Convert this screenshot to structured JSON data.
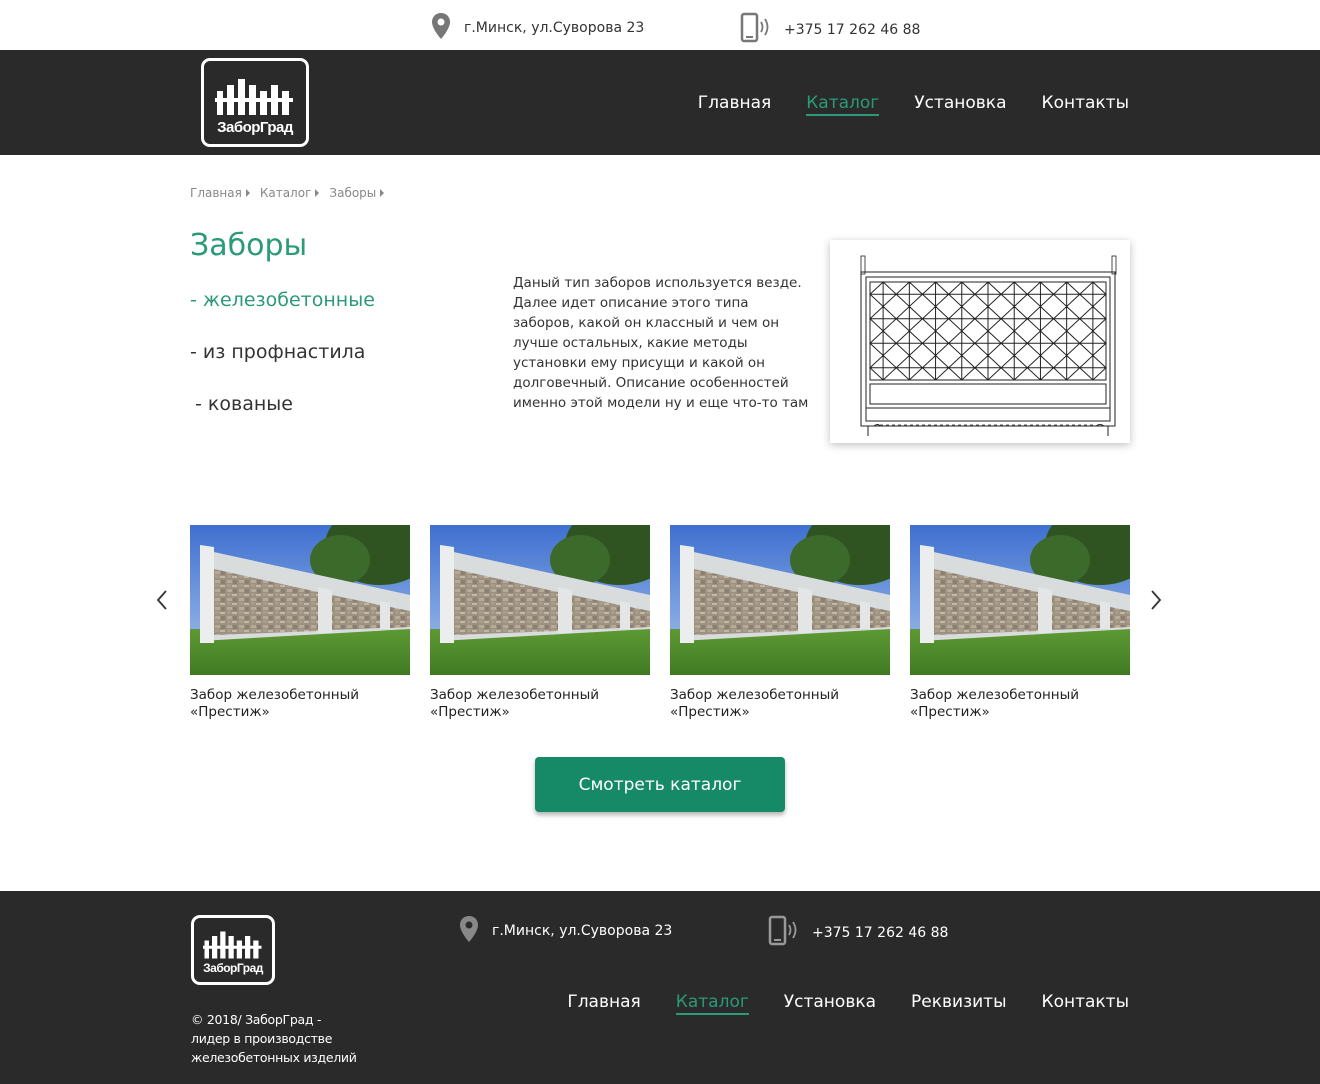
{
  "topbar": {
    "address": "г.Минск, ул.Суворова 23",
    "phone": "+375 17 262 46 88"
  },
  "header": {
    "logo_text": "ЗаборГрад",
    "nav": [
      "Главная",
      "Каталог",
      "Установка",
      "Контакты"
    ],
    "active_nav": "Каталог"
  },
  "breadcrumb": [
    "Главная",
    "Каталог",
    "Заборы"
  ],
  "category": {
    "title": "Заборы",
    "subcategories": [
      "- железобетонные",
      "- из профнастила",
      "- кованые"
    ],
    "active_subcategory": "- железобетонные",
    "description": "Даный тип заборов используется везде. Далее идет описание этого типа заборов, какой он классный и чем он лучше остальных, какие методы установки ему присущи и какой он долговечный. Описание особенностей именно этой модели ну и еще что-то там"
  },
  "products": [
    {
      "line1": "Забор железобетонный",
      "line2": "«Престиж»"
    },
    {
      "line1": "Забор железобетонный",
      "line2": "«Престиж»"
    },
    {
      "line1": "Забор железобетонный",
      "line2": "«Престиж»"
    },
    {
      "line1": "Забор железобетонный",
      "line2": "«Престиж»"
    }
  ],
  "cta": {
    "label": "Смотреть  каталог"
  },
  "footer": {
    "logo_text": "ЗаборГрад",
    "copyright": "© 2018/ ЗаборГрад - лидер в производстве железобетонных изделий",
    "address": "г.Минск, ул.Суворова 23",
    "phone": "+375 17 262 46 88",
    "nav": [
      "Главная",
      "Каталог",
      "Установка",
      "Реквизиты",
      "Контакты"
    ],
    "active_nav": "Каталог"
  },
  "colors": {
    "accent": "#2b9a78",
    "button": "#168a66",
    "dark_bg": "#2a2a2a"
  },
  "icons": [
    "map-pin-icon",
    "phone-icon",
    "fence-logo-icon",
    "chevron-left-icon",
    "chevron-right-icon"
  ]
}
